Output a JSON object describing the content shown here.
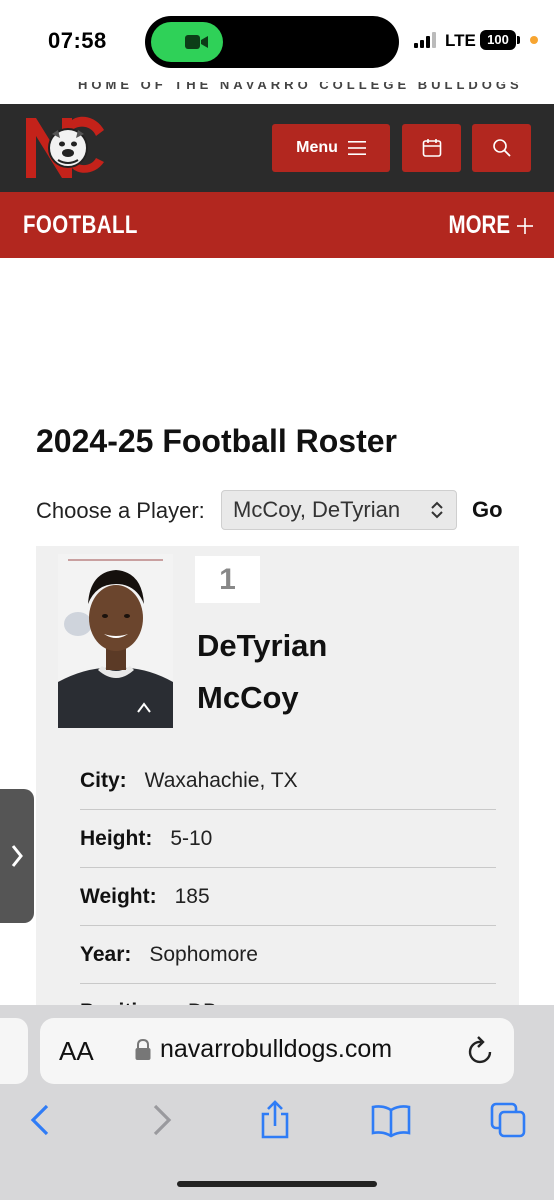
{
  "status_bar": {
    "time": "07:58",
    "network": "LTE",
    "battery": "100"
  },
  "site": {
    "tagline": "HOME OF THE NAVARRO COLLEGE BULLDOGS",
    "menu_label": "Menu",
    "section_title": "FOOTBALL",
    "more_label": "MORE"
  },
  "roster": {
    "title": "2024-25 Football Roster",
    "choose_label": "Choose a Player:",
    "selected_player": "McCoy, DeTyrian",
    "go_label": "Go"
  },
  "player": {
    "number": "1",
    "first_name": "DeTyrian",
    "last_name": "McCoy",
    "details": [
      {
        "key": "City:",
        "value": "Waxahachie, TX"
      },
      {
        "key": "Height:",
        "value": "5-10"
      },
      {
        "key": "Weight:",
        "value": "185"
      },
      {
        "key": "Year:",
        "value": "Sophomore"
      },
      {
        "key": "Position:",
        "value": "DB"
      }
    ]
  },
  "browser": {
    "url": "navarrobulldogs.com",
    "aa_label": "AA"
  },
  "colors": {
    "brand_red": "#b2271f",
    "header_dark": "#2b2b2b",
    "facetime_green": "#2fd158",
    "ios_blue": "#2f7cf6"
  }
}
